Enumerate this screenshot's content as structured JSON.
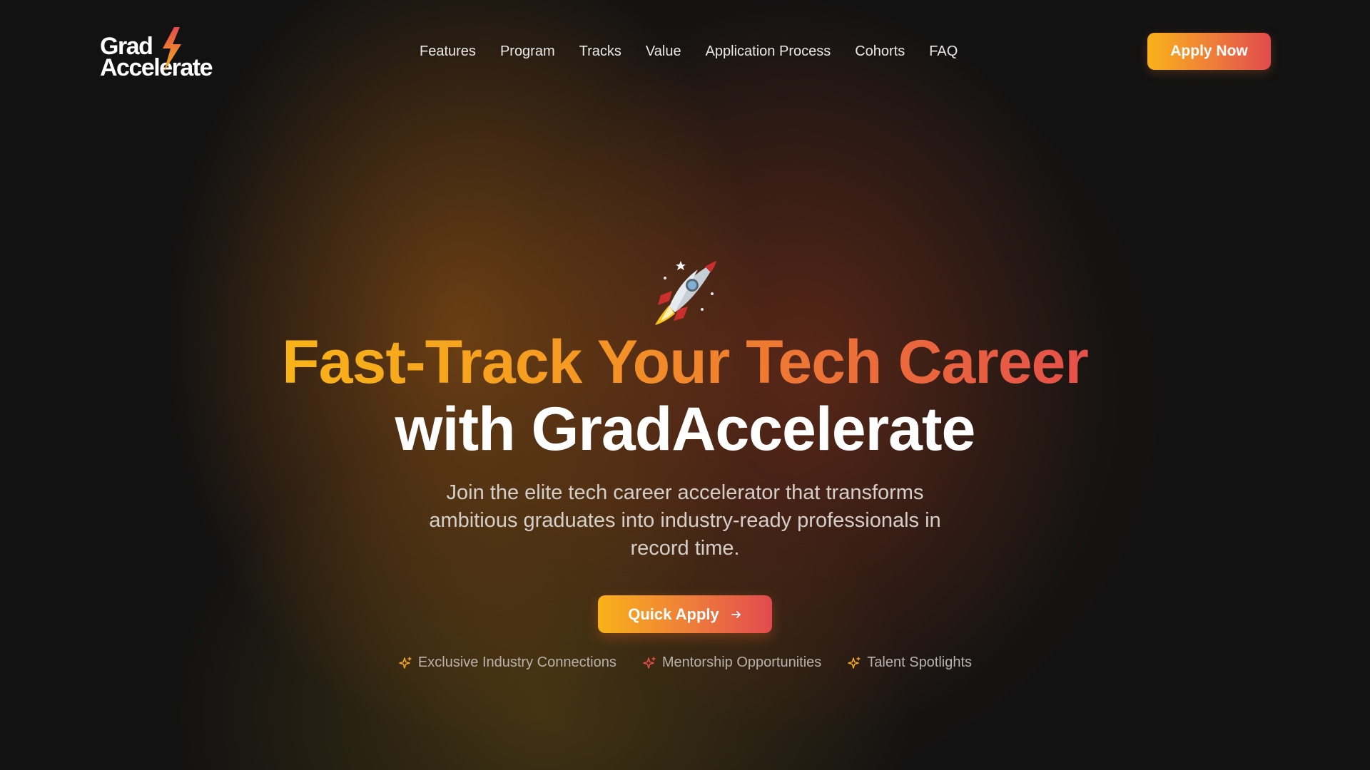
{
  "brand": {
    "line1": "Grad",
    "line2": "Accelerate",
    "bolt_colors": [
      "#f9b21a",
      "#e24a4e"
    ]
  },
  "nav": {
    "items": [
      "Features",
      "Program",
      "Tracks",
      "Value",
      "Application Process",
      "Cohorts",
      "FAQ"
    ]
  },
  "header": {
    "apply_label": "Apply Now"
  },
  "hero": {
    "emoji": "🚀",
    "line1": "Fast-Track Your Tech Career",
    "line2": "with GradAccelerate",
    "subtitle": "Join the elite tech career accelerator that transforms ambitious graduates into industry-ready professionals in record time.",
    "cta_label": "Quick Apply",
    "cta_icon": "arrow-right-icon",
    "perks": [
      {
        "label": "Exclusive Industry Connections",
        "icon": "sparkle-icon",
        "color": "#f5a623"
      },
      {
        "label": "Mentorship Opportunities",
        "icon": "sparkle-icon",
        "color": "#e5504a"
      },
      {
        "label": "Talent Spotlights",
        "icon": "sparkle-icon",
        "color": "#f5a623"
      }
    ]
  },
  "colors": {
    "background": "#121212",
    "gradient_start": "#f9b21a",
    "gradient_end": "#e24a4e",
    "text": "#ffffff",
    "muted": "#b9b3ad"
  }
}
